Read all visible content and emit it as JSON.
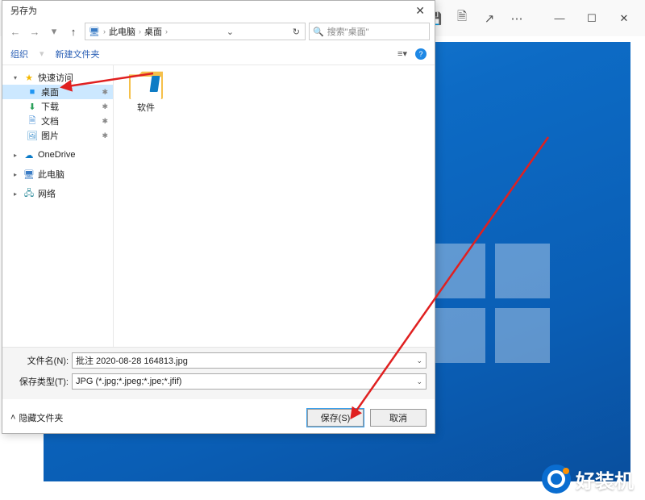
{
  "bg": {
    "toolbar_icons": [
      "search-icon",
      "save-icon",
      "rotate-icon",
      "share-icon",
      "more-icon"
    ],
    "window_icons": [
      "minimize-icon",
      "maximize-icon",
      "close-icon"
    ]
  },
  "dialog": {
    "title": "另存为",
    "breadcrumb": {
      "root": "此电脑",
      "leaf": "桌面"
    },
    "search_placeholder": "搜索\"桌面\"",
    "toolbar": {
      "organize": "组织",
      "new_folder": "新建文件夹"
    },
    "sidebar": {
      "quick": {
        "label": "快速访问",
        "items": [
          {
            "label": "桌面",
            "icon": "folder-blue",
            "selected": true,
            "pinned": true
          },
          {
            "label": "下载",
            "icon": "download",
            "pinned": true
          },
          {
            "label": "文档",
            "icon": "doc",
            "pinned": true
          },
          {
            "label": "图片",
            "icon": "pic",
            "pinned": true
          }
        ]
      },
      "onedrive": "OneDrive",
      "thispc": "此电脑",
      "network": "网络"
    },
    "content": {
      "item1": "软件"
    },
    "footer": {
      "filename_label": "文件名(N):",
      "filename_value": "批注 2020-08-28 164813.jpg",
      "filetype_label": "保存类型(T):",
      "filetype_value": "JPG (*.jpg;*.jpeg;*.jpe;*.jfif)",
      "hide_folders": "隐藏文件夹",
      "save": "保存(S)",
      "cancel": "取消"
    }
  },
  "watermark": "好装机"
}
